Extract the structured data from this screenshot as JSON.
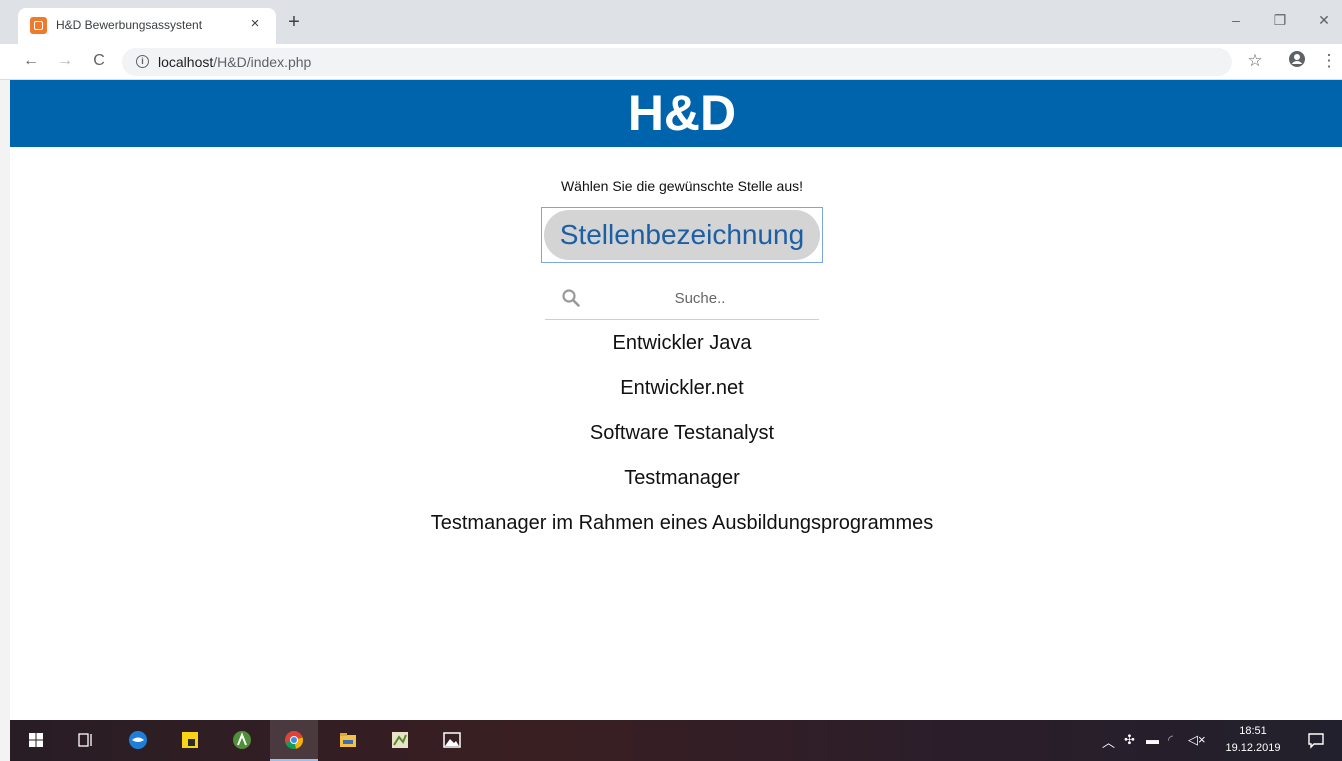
{
  "browser": {
    "tab_title": "H&D Bewerbungsassystent",
    "tab_close": "×",
    "new_tab": "+",
    "url_host": "localhost",
    "url_path": "/H&D/index.php",
    "window_controls": {
      "minimize": "–",
      "restore": "❐",
      "close": "✕"
    }
  },
  "page": {
    "brand": "H&D",
    "prompt": "Wählen Sie die gewünschte Stelle aus!",
    "select_label": "Stellenbezeichnung",
    "search_placeholder": "Suche..",
    "jobs": [
      "Entwickler Java",
      "Entwickler.net",
      "Software Testanalyst",
      "Testmanager",
      "Testmanager im Rahmen eines Ausbildungsprogrammes"
    ],
    "colors": {
      "header": "#0064ad",
      "select_text": "#1c5fa5",
      "select_bg": "#d4d4d4"
    }
  },
  "taskbar": {
    "time": "18:51",
    "date": "19.12.2019",
    "icons": [
      "windows-start-icon",
      "task-view-icon",
      "thunderbird-icon",
      "sticky-notes-icon",
      "android-studio-icon",
      "chrome-icon",
      "file-explorer-icon",
      "gimp-icon",
      "photos-icon"
    ]
  }
}
